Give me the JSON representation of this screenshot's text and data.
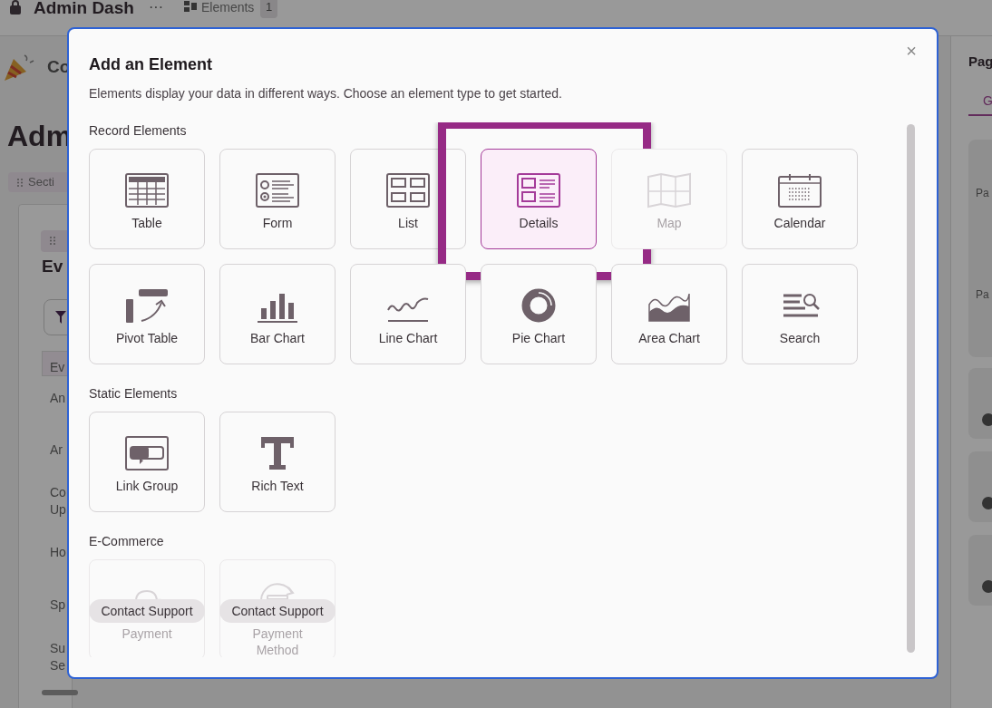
{
  "background": {
    "app_title": "Admin Dash",
    "more": "···",
    "elements_tab": {
      "label": "Elements",
      "count": "1"
    },
    "page_name": "Co",
    "heading": "Adm",
    "section_chip": "Secti",
    "card_heading": "Ev",
    "table_header": "Ev",
    "rows": [
      [
        "An"
      ],
      [
        "Ar"
      ],
      [
        "Co",
        "Up"
      ],
      [
        "Ho"
      ],
      [
        "Sp"
      ],
      [
        "Su",
        "Se"
      ]
    ],
    "panel": {
      "title": "Pag",
      "tab": "G",
      "labels": [
        "Pa",
        "Pa"
      ]
    }
  },
  "modal": {
    "title": "Add an Element",
    "description": "Elements display your data in different ways. Choose an element type to get started.",
    "close": "×",
    "sections": [
      {
        "title": "Record Elements",
        "items": [
          {
            "label": "Table",
            "selected": false,
            "disabled": false,
            "highlighted": false
          },
          {
            "label": "Form",
            "selected": false,
            "disabled": false,
            "highlighted": false
          },
          {
            "label": "List",
            "selected": false,
            "disabled": false,
            "highlighted": false
          },
          {
            "label": "Details",
            "selected": true,
            "disabled": false,
            "highlighted": true
          },
          {
            "label": "Map",
            "selected": false,
            "disabled": true,
            "highlighted": false
          },
          {
            "label": "Calendar",
            "selected": false,
            "disabled": false,
            "highlighted": false
          },
          {
            "label": "Pivot Table",
            "selected": false,
            "disabled": false,
            "highlighted": false
          },
          {
            "label": "Bar Chart",
            "selected": false,
            "disabled": false,
            "highlighted": false
          },
          {
            "label": "Line Chart",
            "selected": false,
            "disabled": false,
            "highlighted": false
          },
          {
            "label": "Pie Chart",
            "selected": false,
            "disabled": false,
            "highlighted": false
          },
          {
            "label": "Area Chart",
            "selected": false,
            "disabled": false,
            "highlighted": false
          },
          {
            "label": "Search",
            "selected": false,
            "disabled": false,
            "highlighted": false
          }
        ]
      },
      {
        "title": "Static Elements",
        "items": [
          {
            "label": "Link Group",
            "selected": false,
            "disabled": false,
            "highlighted": false
          },
          {
            "label": "Rich Text",
            "selected": false,
            "disabled": false,
            "highlighted": false
          }
        ]
      },
      {
        "title": "E-Commerce",
        "items": [
          {
            "label": "Payment",
            "selected": false,
            "disabled": true,
            "highlighted": false,
            "badge": "Contact Support"
          },
          {
            "label": "Payment Method",
            "selected": false,
            "disabled": true,
            "highlighted": false,
            "badge": "Contact Support"
          }
        ]
      }
    ]
  }
}
